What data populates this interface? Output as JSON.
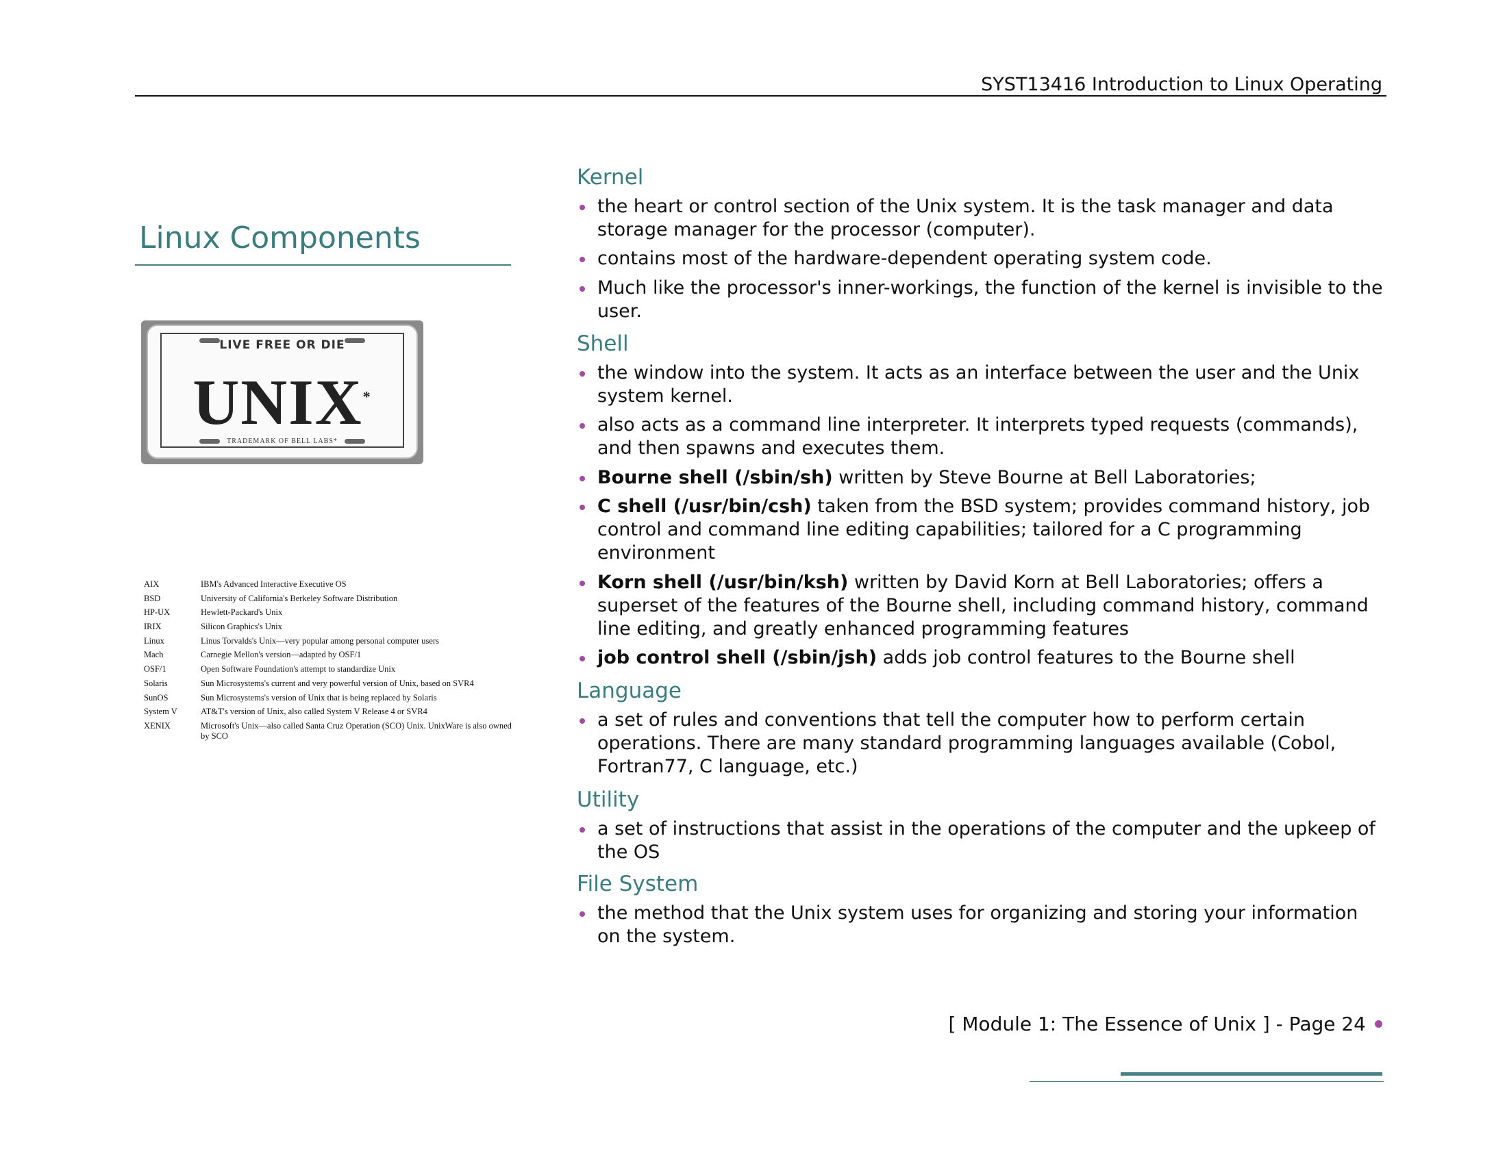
{
  "header": {
    "course": "SYST13416 Introduction to Linux Operating"
  },
  "page_title": "Linux Components",
  "plate": {
    "top": "LIVE FREE OR DIE",
    "main": "UNIX",
    "mark": "*",
    "bottom": "TRADEMARK OF BELL LABS*"
  },
  "variants": [
    {
      "name": "AIX",
      "desc": "IBM's Advanced Interactive Executive OS"
    },
    {
      "name": "BSD",
      "desc": "University of California's Berkeley Software Distribution"
    },
    {
      "name": "HP-UX",
      "desc": "Hewlett-Packard's Unix"
    },
    {
      "name": "IRIX",
      "desc": "Silicon Graphics's Unix"
    },
    {
      "name": "Linux",
      "desc": "Linus Torvalds's Unix—very popular among personal computer users"
    },
    {
      "name": "Mach",
      "desc": "Carnegie Mellon's version—adapted by OSF/1"
    },
    {
      "name": "OSF/1",
      "desc": "Open Software Foundation's attempt to standardize Unix"
    },
    {
      "name": "Solaris",
      "desc": "Sun Microsystems's current and very powerful version of Unix, based on SVR4"
    },
    {
      "name": "SunOS",
      "desc": "Sun Microsystems's version of Unix that is being replaced by Solaris"
    },
    {
      "name": "System V",
      "desc": "AT&T's version of Unix, also called System V Release 4 or SVR4"
    },
    {
      "name": "XENIX",
      "desc": "Microsoft's Unix—also called Santa Cruz Operation (SCO) Unix. UnixWare is also owned by SCO"
    }
  ],
  "sections": [
    {
      "heading": "Kernel",
      "bullets": [
        {
          "bold": "",
          "text": "the heart or control section of the Unix system.  It is the task manager and data storage manager for the processor (computer)."
        },
        {
          "bold": "",
          "text": "contains most of the hardware-dependent operating system code."
        },
        {
          "bold": "",
          "text": "Much like the processor's inner-workings, the function of the kernel is invisible to the user."
        }
      ]
    },
    {
      "heading": "Shell",
      "bullets": [
        {
          "bold": "",
          "text": "the window into the system. It acts as an interface between the user and the Unix system kernel."
        },
        {
          "bold": "",
          "text": "also acts as a command line interpreter. It interprets typed requests (commands), and then spawns and executes them."
        },
        {
          "bold": "Bourne shell (/sbin/sh)",
          "text": " written by Steve Bourne at Bell Laboratories;"
        },
        {
          "bold": "C shell (/usr/bin/csh)",
          "text": " taken from the BSD system; provides command history, job control and command line editing capabilities; tailored for a C programming environment"
        },
        {
          "bold": "Korn shell (/usr/bin/ksh)",
          "text": " written by David Korn at Bell Laboratories; offers a superset of the features of the Bourne shell, including command history, command line editing, and greatly enhanced programming features"
        },
        {
          "bold": "job control shell (/sbin/jsh)",
          "text": " adds job control features to the Bourne shell"
        }
      ]
    },
    {
      "heading": "Language",
      "bullets": [
        {
          "bold": "",
          "text": "a set of rules and conventions that tell the computer how to perform certain operations.  There are many standard programming languages available (Cobol, Fortran77, C language, etc.)"
        }
      ]
    },
    {
      "heading": "Utility",
      "bullets": [
        {
          "bold": "",
          "text": "a set of instructions that assist in the operations of the computer and the upkeep of the OS"
        }
      ]
    },
    {
      "heading": "File System",
      "bullets": [
        {
          "bold": "",
          "text": "the method that the Unix system uses for organizing and storing your information on the system."
        }
      ]
    }
  ],
  "footer": {
    "text": "[ Module 1:  The Essence of Unix  ] - Page 24"
  },
  "colors": {
    "heading": "#3a7d80",
    "bullet": "#a34ba3",
    "rule": "#4a7f85"
  }
}
